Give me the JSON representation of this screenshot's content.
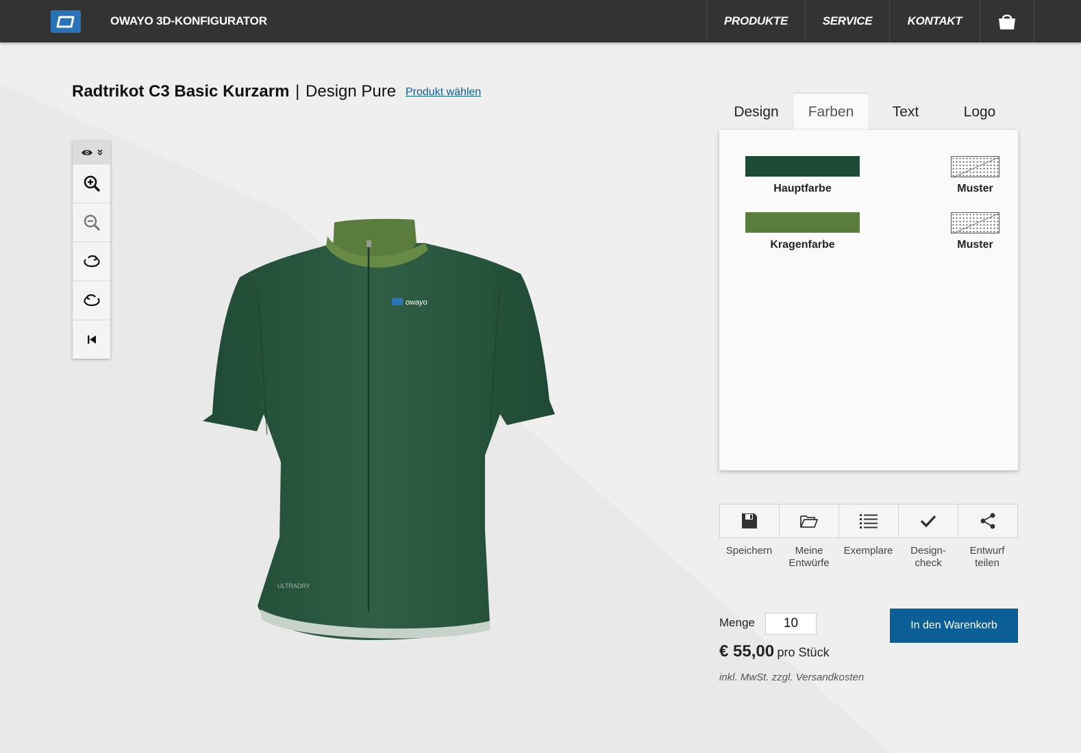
{
  "header": {
    "title": "OWAYO 3D-KONFIGURATOR",
    "nav": [
      {
        "label": "PRODUKTE"
      },
      {
        "label": "SERVICE"
      },
      {
        "label": "KONTAKT"
      }
    ]
  },
  "product": {
    "name": "Radtrikot C3 Basic Kurzarm",
    "separator": "|",
    "design": "Design Pure",
    "choose_link": "Produkt wählen"
  },
  "jersey": {
    "chest_logo": "owayo",
    "hem_label": "ULTRADRY"
  },
  "tabs": [
    {
      "label": "Design",
      "active": false
    },
    {
      "label": "Farben",
      "active": true
    },
    {
      "label": "Text",
      "active": false
    },
    {
      "label": "Logo",
      "active": false
    }
  ],
  "colors": {
    "main": {
      "label": "Hauptfarbe",
      "color": "#1e4b37",
      "pattern_label": "Muster"
    },
    "collar": {
      "label": "Kragenfarbe",
      "color": "#5a7d3e",
      "pattern_label": "Muster"
    }
  },
  "actions": [
    {
      "label": "Speichern",
      "icon": "save-icon"
    },
    {
      "label": "Meine Entwürfe",
      "icon": "folder-icon"
    },
    {
      "label": "Exemplare",
      "icon": "list-icon"
    },
    {
      "label": "Design-check",
      "icon": "check-icon"
    },
    {
      "label": "Entwurf teilen",
      "icon": "share-icon"
    }
  ],
  "order": {
    "quantity_label": "Menge",
    "quantity": "10",
    "price": "€ 55,00",
    "price_unit": "pro Stück",
    "tax_note": "inkl. MwSt. zzgl. Versandkosten",
    "cart_button": "In den Warenkorb"
  },
  "colors_theme": {
    "header_bg": "#333333",
    "accent": "#0c5e97",
    "logo_blue": "#2a73b8"
  }
}
